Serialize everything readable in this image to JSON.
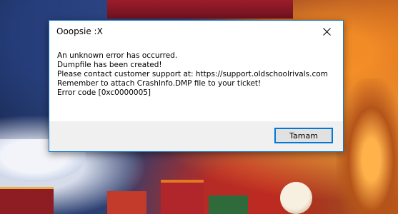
{
  "dialog": {
    "title": "Ooopsie :X",
    "close_icon": "close-icon",
    "message_lines": [
      "An unknown error has occurred.",
      "Dumpfile has been created!",
      "Please contact customer support at: https://support.oldschoolrivals.com",
      "Remember to attach CrashInfo.DMP file to your ticket!",
      "Error code [0xc0000005]"
    ],
    "ok_label": "Tamam"
  },
  "colors": {
    "accent": "#0078d7",
    "title_border": "#1979ca",
    "footer_bg": "#f0f0f0",
    "button_bg": "#e1e1e1"
  }
}
